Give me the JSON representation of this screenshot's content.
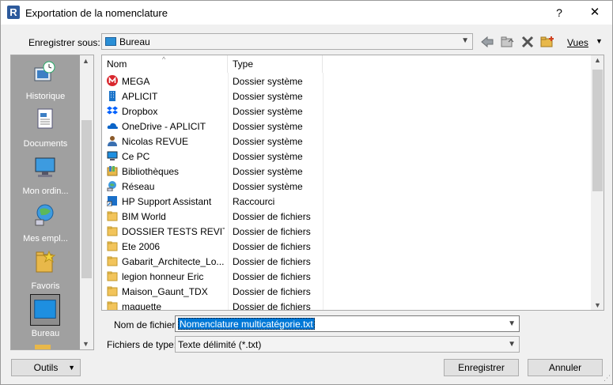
{
  "window": {
    "title": "Exportation de la nomenclature",
    "app_icon_letter": "R",
    "help_glyph": "?",
    "close_glyph": "✕"
  },
  "toolbar": {
    "save_in_label": "Enregistrer sous:",
    "location": "Bureau",
    "views_label": "Vues"
  },
  "places": [
    {
      "label": "Historique",
      "icon": "history-icon"
    },
    {
      "label": "Documents",
      "icon": "documents-icon"
    },
    {
      "label": "Mon ordin...",
      "icon": "computer-icon"
    },
    {
      "label": "Mes empl...",
      "icon": "network-places-icon"
    },
    {
      "label": "Favoris",
      "icon": "favorites-icon"
    },
    {
      "label": "Bureau",
      "icon": "desktop-icon",
      "selected": true
    }
  ],
  "list": {
    "columns": [
      "Nom",
      "Type"
    ],
    "rows": [
      {
        "name": "MEGA",
        "type": "Dossier système",
        "icon": "mega-icon"
      },
      {
        "name": "APLICIT",
        "type": "Dossier système",
        "icon": "building-icon"
      },
      {
        "name": "Dropbox",
        "type": "Dossier système",
        "icon": "dropbox-icon"
      },
      {
        "name": "OneDrive - APLICIT",
        "type": "Dossier système",
        "icon": "onedrive-icon"
      },
      {
        "name": "Nicolas REVUE",
        "type": "Dossier système",
        "icon": "user-icon"
      },
      {
        "name": "Ce PC",
        "type": "Dossier système",
        "icon": "pc-icon"
      },
      {
        "name": "Bibliothèques",
        "type": "Dossier système",
        "icon": "libraries-icon"
      },
      {
        "name": "Réseau",
        "type": "Dossier système",
        "icon": "network-icon"
      },
      {
        "name": "HP Support Assistant",
        "type": "Raccourci",
        "icon": "shortcut-icon"
      },
      {
        "name": "BIM World",
        "type": "Dossier de fichiers",
        "icon": "folder-icon"
      },
      {
        "name": "DOSSIER TESTS REVIT",
        "type": "Dossier de fichiers",
        "icon": "folder-icon"
      },
      {
        "name": "Ete 2006",
        "type": "Dossier de fichiers",
        "icon": "folder-icon"
      },
      {
        "name": "Gabarit_Architecte_Lo...",
        "type": "Dossier de fichiers",
        "icon": "folder-icon"
      },
      {
        "name": "legion honneur Eric",
        "type": "Dossier de fichiers",
        "icon": "folder-icon"
      },
      {
        "name": "Maison_Gaunt_TDX",
        "type": "Dossier de fichiers",
        "icon": "folder-icon"
      },
      {
        "name": "maquette",
        "type": "Dossier de fichiers",
        "icon": "folder-icon"
      }
    ]
  },
  "form": {
    "file_name_label": "Nom de fichier:",
    "file_name_value": "Nomenclature multicatégorie.txt",
    "file_type_label": "Fichiers de type:",
    "file_type_value": "Texte délimité  (*.txt)"
  },
  "buttons": {
    "tools": "Outils",
    "save": "Enregistrer",
    "cancel": "Annuler"
  }
}
